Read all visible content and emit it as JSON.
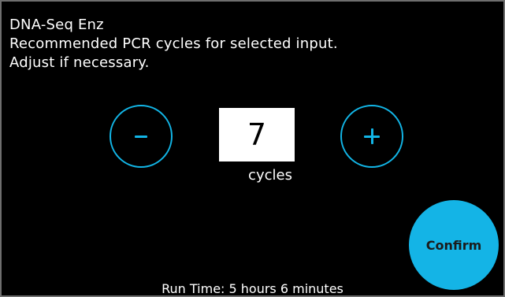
{
  "header": {
    "title": "DNA-Seq Enz",
    "line2": "Recommended PCR cycles for selected input.",
    "line3": "Adjust if necessary."
  },
  "cycles": {
    "value": "7",
    "unit": "cycles",
    "decrement_icon": "minus-icon",
    "increment_icon": "plus-icon"
  },
  "actions": {
    "confirm_label": "Confirm"
  },
  "footer": {
    "run_time": "Run Time: 5 hours 6 minutes"
  },
  "colors": {
    "background": "#000000",
    "accent": "#12b5e6",
    "text": "#ffffff",
    "value_box": "#ffffff"
  }
}
